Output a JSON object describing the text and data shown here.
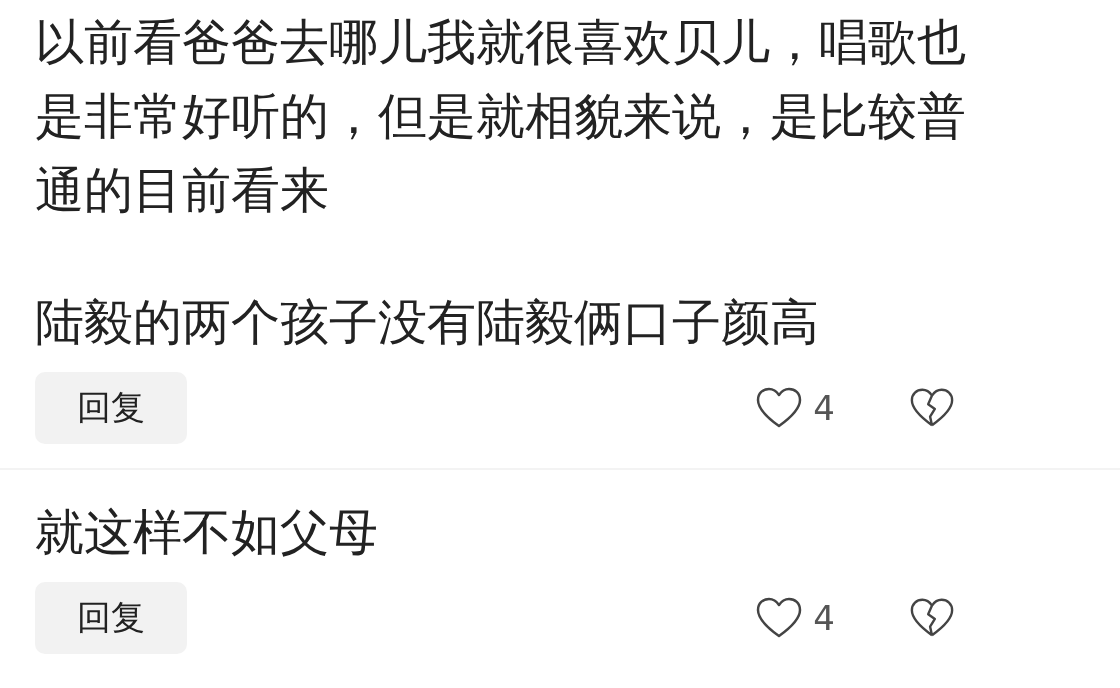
{
  "comments": [
    {
      "paragraphs": [
        "以前看爸爸去哪儿我就很喜欢贝儿，唱歌也是非常好听的，但是就相貌来说，是比较普通的目前看来",
        "陆毅的两个孩子没有陆毅俩口子颜高"
      ],
      "reply_label": "回复",
      "like_count": "4"
    },
    {
      "paragraphs": [
        "就这样不如父母"
      ],
      "reply_label": "回复",
      "like_count": "4"
    }
  ]
}
